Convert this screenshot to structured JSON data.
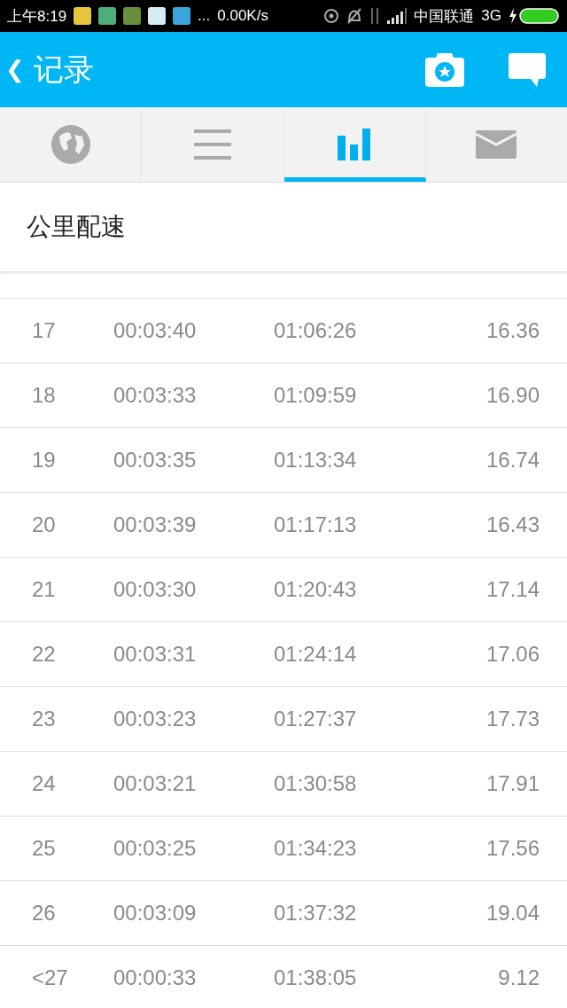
{
  "status_bar": {
    "time": "上午8:19",
    "more": "...",
    "speed": "0.00K/s",
    "carrier": "中国联通",
    "network": "3G"
  },
  "app_bar": {
    "back": "❮",
    "title": "记录"
  },
  "tabs": [
    {
      "kind": "map",
      "selected": false
    },
    {
      "kind": "list",
      "selected": false
    },
    {
      "kind": "chart",
      "selected": true
    },
    {
      "kind": "mail",
      "selected": false
    }
  ],
  "section_title": "公里配速",
  "rows": [
    [
      "17",
      "00:03:40",
      "01:06:26",
      "16.36"
    ],
    [
      "18",
      "00:03:33",
      "01:09:59",
      "16.90"
    ],
    [
      "19",
      "00:03:35",
      "01:13:34",
      "16.74"
    ],
    [
      "20",
      "00:03:39",
      "01:17:13",
      "16.43"
    ],
    [
      "21",
      "00:03:30",
      "01:20:43",
      "17.14"
    ],
    [
      "22",
      "00:03:31",
      "01:24:14",
      "17.06"
    ],
    [
      "23",
      "00:03:23",
      "01:27:37",
      "17.73"
    ],
    [
      "24",
      "00:03:21",
      "01:30:58",
      "17.91"
    ],
    [
      "25",
      "00:03:25",
      "01:34:23",
      "17.56"
    ],
    [
      "26",
      "00:03:09",
      "01:37:32",
      "19.04"
    ],
    [
      "<27",
      "00:00:33",
      "01:38:05",
      "9.12"
    ]
  ]
}
